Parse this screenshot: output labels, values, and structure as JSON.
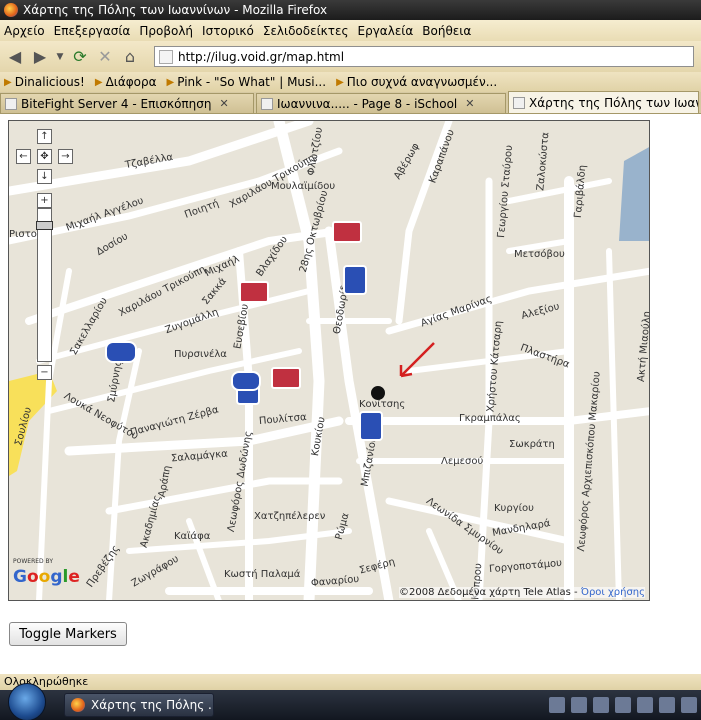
{
  "window": {
    "title": "Χάρτης της Πόλης των Ιωαννίνων - Mozilla Firefox"
  },
  "menu": [
    "Αρχείο",
    "Επεξεργασία",
    "Προβολή",
    "Ιστορικό",
    "Σελιδοδείκτες",
    "Εργαλεία",
    "Βοήθεια"
  ],
  "nav": {
    "url": "http://ilug.void.gr/map.html"
  },
  "bookmarks": [
    "Dinalicious!",
    "Διάφορα",
    "Pink - \"So What\" | Musi...",
    "Πιο συχνά αναγνωσμέν..."
  ],
  "tabs": [
    {
      "label": "BiteFight Server 4 - Επισκόπηση",
      "active": false
    },
    {
      "label": "Ιωαννινα..... - Page 8 - iSchool",
      "active": false
    },
    {
      "label": "Χάρτης της Πόλης των Ιωαννίν",
      "active": true
    }
  ],
  "map": {
    "streets": [
      "Τζαβέλλα",
      "Μιχαήλ Αγγέλου",
      "Δοσίου",
      "Ποιητή",
      "Χαριλάου Τρικούπη",
      "Φλωτζίου",
      "Μουλαϊμίδου",
      "28ης Οκτωβρίου",
      "Αβέρωφ",
      "Καραπάνου",
      "Γεωργίου Σταύρου",
      "Γαριβάλδη",
      "Ζαλοκώστα",
      "Μετσόβου",
      "Χαριλάου Τρικούπη",
      "Μιχαήλ",
      "Βλαχίδου",
      "Ζυγομάλλη",
      "Σακκά",
      "Σακελλαρίου",
      "Αγίας Μαρίνας",
      "Αλεξίου",
      "Πλαστήρα",
      "Ακτή Μιαούλη",
      "Πυρσινέλα",
      "Σμύρνης",
      "Θεοδωρίδη",
      "Μπιζανίου",
      "Κονίτσης",
      "Γκραμπάλας",
      "Σωκράτη",
      "Λεμεσού",
      "Παναγιώτη Ζέρβα",
      "Πουλίτσα",
      "Λουκά Νεοφύτου",
      "Σαλαμάγκα",
      "Αράπη",
      "Σουλίου",
      "Χατζηπέλερεν",
      "Καϊάφα",
      "Ακαδημίας",
      "Πρεβέζης",
      "Ζωγράφου",
      "Κωστή Παλαμά",
      "Ρώμα",
      "Φαναρίου",
      "Σεφέρη",
      "Λεωνίδα Σμυρνίου",
      "Κυργίου",
      "Μανδηλαρά",
      "Γοργοποτάμου",
      "Λεωφόρος Αρχιεπισκόπου Μακαρίου",
      "Λεωφόρος Δωδώνης",
      "Κουκίου",
      "Χρήστου Κάτσαρη",
      "Ριστο",
      "Ευσεβίου",
      "Κυπρου",
      "Λεωνίδα Σμυρνίου"
    ],
    "powered_by": "POWERED BY",
    "google_logo": "Google",
    "copyright": "©2008 Δεδομένα χάρτη Tele Atlas - ",
    "terms_link": "Όροι χρήσης"
  },
  "toggle_button": "Toggle Markers",
  "status": "Ολοκληρώθηκε",
  "taskbar": {
    "item": "Χάρτης της Πόλης ..."
  },
  "colors": {
    "road": "#ffffff",
    "map_bg": "#e8e4d9",
    "water": "#99b3cc",
    "highway": "#f8e05a",
    "arrow": "#d42020"
  }
}
